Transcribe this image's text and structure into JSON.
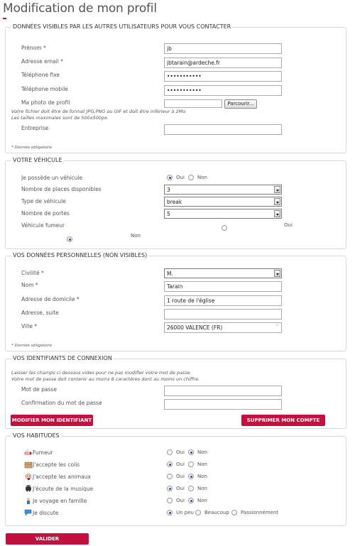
{
  "page_title": "Modification de mon profil",
  "contact": {
    "legend": "DONNÉES VISIBLES PAR LES AUTRES UTILISATEURS POUR VOUS CONTACTER",
    "prenom_label": "Prénom *",
    "prenom_value": "jb",
    "email_label": "Adresse email *",
    "email_value": "jbtarain@ardeche.fr",
    "tel_fixe_label": "Téléphone fixe",
    "tel_fixe_value": "•••••••••••",
    "tel_mobile_label": "Téléphone mobile",
    "tel_mobile_value": "•••••••••••",
    "photo_label": "Ma photo de profil",
    "browse_label": "Parcourir...",
    "photo_note1": "Votre fichier doit être de format JPG,PNG ou GIF et doit être inférieur à 2Mo",
    "photo_note2": "Les tailles maximales sont de 500x500px.",
    "entreprise_label": "Entreprise",
    "entreprise_value": "",
    "required_note": "* Donnée obligatoire"
  },
  "vehicule": {
    "legend": "VOTRE VÉHICULE",
    "possede_label": "Je possède un véhicule",
    "oui": "Oui",
    "non": "Non",
    "places_label": "Nombre de places disponibles",
    "places_value": "3",
    "type_label": "Type de véhicule",
    "type_value": "break",
    "portes_label": "Nombre de portes",
    "portes_value": "5",
    "fumeur_label": "Véhicule fumeur",
    "fumeur_oui": "Oui",
    "fumeur_non": "Non"
  },
  "perso": {
    "legend": "VOS DONNÉES PERSONNELLES (NON VISIBLES)",
    "civilite_label": "Civilité *",
    "civilite_value": "M.",
    "nom_label": "Nom *",
    "nom_value": "Tarain",
    "adresse_label": "Adresse de domicile *",
    "adresse_value": "1 route de l'église",
    "adresse_suite_label": "Adresse, suite",
    "adresse_suite_value": "",
    "ville_label": "Ville *",
    "ville_value": "26000 VALENCE (FR)",
    "required_note": "* Donnée obligatoire"
  },
  "connexion": {
    "legend": "VOS IDENTIFIANTS DE CONNEXION",
    "note1": "Laisser les champs ci dessous vides pour ne pas modifier votre mot de passe",
    "note2": "Votre mot de passe doit contenir au moins 8 caractères dont au moins un chiffre.",
    "mdp_label": "Mot de passe",
    "confirm_label": "Confirmation du mot de passe",
    "modifier_btn": "MODIFIER MON IDENTIFIANT",
    "supprimer_btn": "SUPPRIMER MON COMPTE"
  },
  "habitudes": {
    "legend": "VOS HABITUDES",
    "oui": "Oui",
    "non": "Non",
    "items": [
      {
        "label": "Fumeur"
      },
      {
        "label": "J'accepte les colis"
      },
      {
        "label": "J'accepte les animaux"
      },
      {
        "label": "J'écoute de la musique"
      },
      {
        "label": "Je voyage en famille"
      },
      {
        "label": "Je discute"
      }
    ],
    "discute_opts": [
      "Un peu",
      "Beaucoup",
      "Passionnément"
    ]
  },
  "valider_btn": "VALIDER",
  "colors": {
    "accent": "#c4103e",
    "radio": "#1f4fbf"
  }
}
